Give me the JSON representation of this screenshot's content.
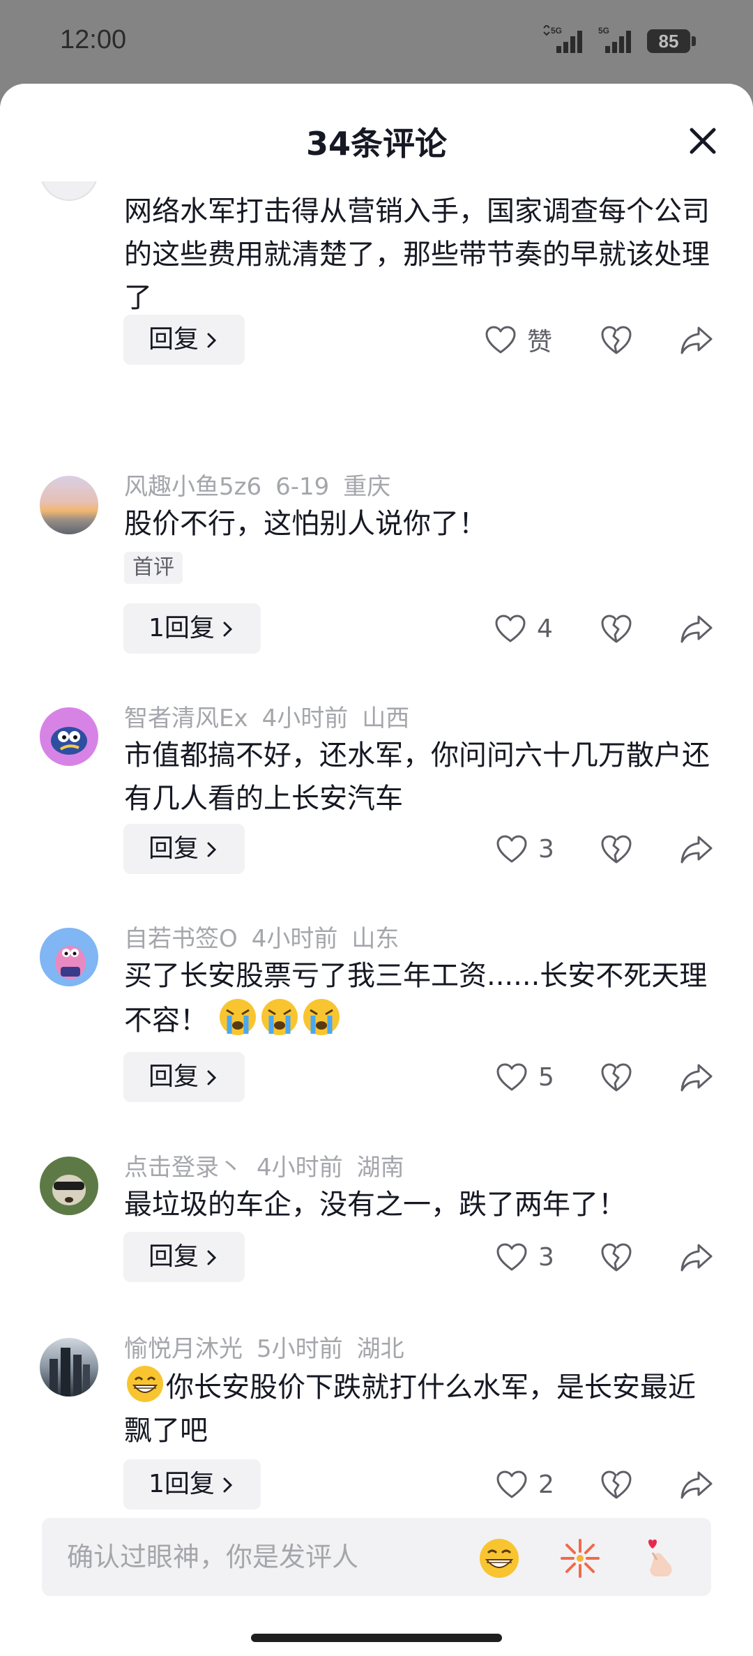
{
  "status_bar": {
    "time": "12:00",
    "battery": "85",
    "network1": "5G",
    "network2": "5G"
  },
  "sheet": {
    "title": "34条评论"
  },
  "comments": [
    {
      "text": "网络水军打击得从营销入手，国家调查每个公司的这些费用就清楚了，那些带节奏的早就该处理了",
      "reply": "回复",
      "likes": "赞"
    },
    {
      "user": "风趣小鱼5z6",
      "time": "6-19",
      "location": "重庆",
      "text": "股价不行，这怕别人说你了！",
      "tag": "首评",
      "reply": "1回复",
      "likes": "4"
    },
    {
      "user": "智者清风Ex",
      "time": "4小时前",
      "location": "山西",
      "text": "市值都搞不好，还水军，你问问六十几万散户还有几人看的上长安汽车",
      "reply": "回复",
      "likes": "3"
    },
    {
      "user": "自若书签O",
      "time": "4小时前",
      "location": "山东",
      "text": "买了长安股票亏了我三年工资......长安不死天理不容！",
      "reply": "回复",
      "likes": "5"
    },
    {
      "user": "点击登录丶",
      "time": "4小时前",
      "location": "湖南",
      "text": "最垃圾的车企，没有之一，跌了两年了！",
      "reply": "回复",
      "likes": "3"
    },
    {
      "user": "愉悦月沐光",
      "time": "5小时前",
      "location": "湖北",
      "text": "你长安股价下跌就打什么水军，是长安最近飘了吧",
      "reply": "1回复",
      "likes": "2"
    }
  ],
  "input": {
    "placeholder": "确认过眼神，你是发评人"
  },
  "colors": {
    "text": "#161823",
    "meta": "#a4a6ab",
    "chip": "#f2f2f4"
  }
}
